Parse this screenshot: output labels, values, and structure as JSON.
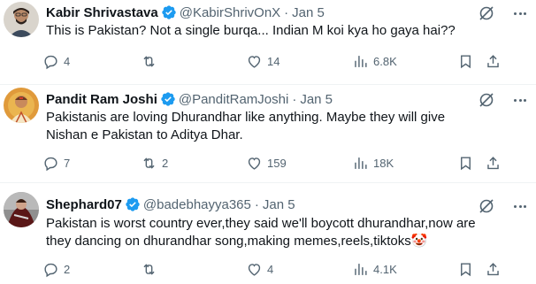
{
  "replies": [
    {
      "name": "Kabir Shrivastava",
      "handle": "@KabirShrivOnX",
      "date": "Jan 5",
      "text": "This is Pakistan? Not a single burqa... Indian M koi kya ho gaya hai??",
      "reply_count": "4",
      "repost_count": "",
      "like_count": "14",
      "view_count": "6.8K"
    },
    {
      "name": "Pandit Ram Joshi",
      "handle": "@PanditRamJoshi",
      "date": "Jan 5",
      "text": "Pakistanis are loving Dhurandhar like anything. Maybe they will give Nishan e Pakistan to Aditya Dhar.",
      "reply_count": "7",
      "repost_count": "2",
      "like_count": "159",
      "view_count": "18K"
    },
    {
      "name": "Shephard07",
      "handle": "@badebhayya365",
      "date": "Jan 5",
      "text": "Pakistan is worst country ever,they said we'll boycott dhurandhar,now are they dancing on dhurandhar song,making memes,reels,tiktoks",
      "emoji": "🤡",
      "reply_count": "2",
      "repost_count": "",
      "like_count": "4",
      "view_count": "4.1K"
    }
  ],
  "separator": "·",
  "colors": {
    "text": "#0f1419",
    "muted": "#536471",
    "verified": "#1d9bf0",
    "divider": "#eff3f4"
  },
  "icons": [
    "verified-badge-icon",
    "grok-icon",
    "more-icon",
    "reply-icon",
    "repost-icon",
    "like-icon",
    "views-icon",
    "bookmark-icon",
    "share-icon"
  ]
}
